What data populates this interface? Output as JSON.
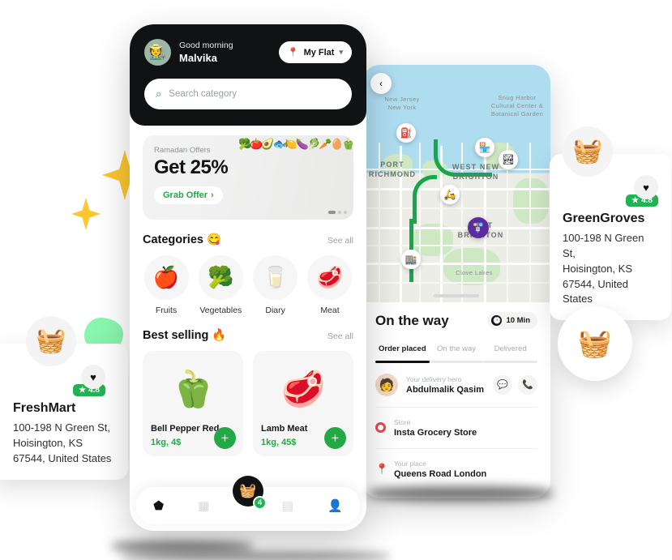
{
  "app": {
    "header": {
      "greeting": "Good morning",
      "user_name": "Malvika",
      "avatar_icon": "user-avatar",
      "location_label": "My Flat",
      "location_icon": "map-pin-icon",
      "chevron_icon": "chevron-down-icon"
    },
    "search": {
      "placeholder": "Search category",
      "icon": "search-icon"
    },
    "promo": {
      "kicker": "Ramadan Offers",
      "title": "Get 25%",
      "cta": "Grab Offer",
      "cta_chevron": "chevron-right-icon",
      "image_emoji": "🥦🍅🥑🐟🍋🍆🥬🥕🥚🫑"
    },
    "categories_section": {
      "title": "Categories",
      "title_emoji": "😋",
      "see_all": "See all",
      "items": [
        {
          "label": "Fruits",
          "icon": "apple-icon",
          "emoji": "🍎"
        },
        {
          "label": "Vegetables",
          "icon": "broccoli-icon",
          "emoji": "🥦"
        },
        {
          "label": "Diary",
          "icon": "milk-icon",
          "emoji": "🥛"
        },
        {
          "label": "Meat",
          "icon": "meat-icon",
          "emoji": "🥩"
        }
      ]
    },
    "best_selling": {
      "title": "Best selling",
      "title_emoji": "🔥",
      "see_all": "See all",
      "products": [
        {
          "name": "Bell Pepper Red",
          "meta": "1kg, 4$",
          "emoji": "🫑",
          "add_icon": "plus-icon"
        },
        {
          "name": "Lamb Meat",
          "meta": "1kg, 45$",
          "emoji": "🥩",
          "add_icon": "plus-icon"
        }
      ]
    },
    "tabbar": {
      "items": [
        {
          "name": "home",
          "icon": "home-icon",
          "glyph": "⬟",
          "active": true
        },
        {
          "name": "categories",
          "icon": "grid-icon",
          "glyph": "▦",
          "active": false
        },
        {
          "name": "orders",
          "icon": "receipt-icon",
          "glyph": "▤",
          "active": false
        },
        {
          "name": "profile",
          "icon": "person-icon",
          "glyph": "👤",
          "active": false
        }
      ],
      "cart": {
        "icon": "basket-icon",
        "glyph": "🧺",
        "badge_count": "4"
      }
    }
  },
  "tracking": {
    "back_icon": "chevron-left-icon",
    "title": "On the way",
    "eta": "10 Min",
    "eta_icon": "clock-icon",
    "tabs": [
      {
        "label": "Order placed",
        "active": true
      },
      {
        "label": "On the way",
        "active": false
      },
      {
        "label": "Delivered",
        "active": false
      }
    ],
    "rows": [
      {
        "label": "Your delivery hero",
        "value": "Abdulmalik Qasim",
        "icon": "courier-avatar",
        "emoji": "🧑",
        "actions": [
          {
            "name": "chat-button",
            "icon": "chat-icon",
            "glyph": "💬"
          },
          {
            "name": "call-button",
            "icon": "phone-icon",
            "glyph": "📞"
          }
        ]
      },
      {
        "label": "Store",
        "value": "Insta Grocery Store",
        "icon": "store-ring-icon"
      },
      {
        "label": "Your place",
        "value": "Queens Road London",
        "icon": "location-pin-icon"
      }
    ],
    "map": {
      "labels": [
        {
          "text": "New Jersey",
          "big": false
        },
        {
          "text": "New York",
          "big": false
        },
        {
          "text": "Snug Harbor Cultural Center & Botanical Garden",
          "big": false
        },
        {
          "text": "PORT RICHMOND",
          "big": true
        },
        {
          "text": "WEST NEW BRIGHTON",
          "big": true
        },
        {
          "text": "WEST BRIGHTON",
          "big": true
        },
        {
          "text": "Clove Lakes",
          "big": false
        }
      ],
      "pois": [
        {
          "name": "gas-station-marker",
          "emoji": "⛽"
        },
        {
          "name": "shop-marker",
          "emoji": "🏪"
        },
        {
          "name": "park-marker",
          "emoji": "🏞"
        },
        {
          "name": "scooter-courier-marker",
          "emoji": "🛵"
        },
        {
          "name": "destination-store-marker",
          "emoji": "🏬"
        },
        {
          "name": "transit-marker",
          "emoji": "🚏"
        }
      ],
      "route_color": "#18A64B"
    }
  },
  "store_cards": [
    {
      "name": "FreshMart",
      "address_lines": [
        "100-198 N Green St,",
        "Hoisington, KS",
        "67544, United States"
      ],
      "rating": "4.8",
      "rating_star": "★",
      "basket_icon": "shopping-basket-icon",
      "basket_emoji": "🧺",
      "heart_icon": "heart-icon"
    },
    {
      "name": "GreenGroves",
      "address_lines": [
        "100-198 N Green St,",
        "Hoisington, KS",
        "67544, United States"
      ],
      "rating": "4.8",
      "rating_star": "★",
      "basket_icon": "shopping-basket-icon",
      "basket_emoji": "🧺",
      "heart_icon": "heart-icon"
    }
  ],
  "decor": {
    "floating_basket_icon": "basket-icon",
    "floating_basket_emoji": "🧺",
    "sparkle_color": "#FBC62F",
    "blob_color": "#8AF7AE",
    "accent_green": "#22A845",
    "badge_green": "#22B254",
    "dark": "#101213"
  }
}
